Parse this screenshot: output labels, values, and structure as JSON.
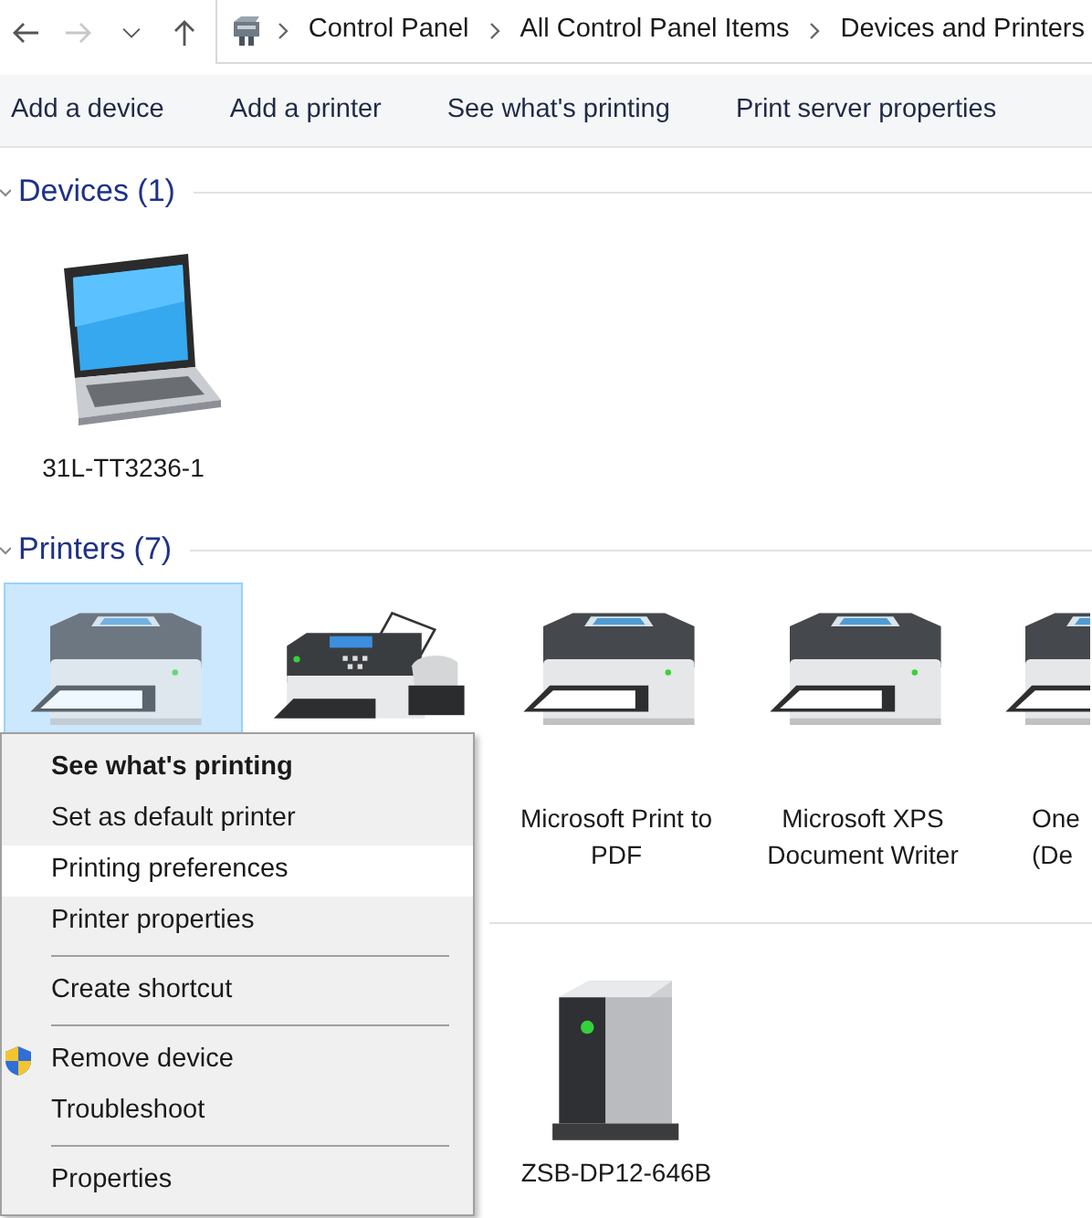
{
  "nav": [
    {
      "kind": "back",
      "disabled": false
    },
    {
      "kind": "forward",
      "disabled": true
    },
    {
      "kind": "recent",
      "disabled": false
    },
    {
      "kind": "up",
      "disabled": false
    }
  ],
  "breadcrumb": [
    "Control Panel",
    "All Control Panel Items",
    "Devices and Printers"
  ],
  "toolbar": [
    "Add a device",
    "Add a printer",
    "See what's printing",
    "Print server properties"
  ],
  "groups": [
    {
      "title": "Devices (1)",
      "items": [
        {
          "kind": "laptop",
          "label": "31L-TT3236-1",
          "selected": false
        }
      ]
    },
    {
      "title": "Printers (7)",
      "items": [
        {
          "kind": "printer",
          "selected": true
        },
        {
          "kind": "fax",
          "selected": false
        },
        {
          "kind": "printer",
          "label": "Microsoft Print to PDF",
          "selected": false
        },
        {
          "kind": "printer",
          "label": "Microsoft XPS Document Writer",
          "selected": false
        },
        {
          "kind": "printer",
          "label": "One (De",
          "selected": false
        }
      ]
    },
    {
      "items": [
        {
          "kind": "storage",
          "label": "ZSB-DP12-646B",
          "selected": false
        }
      ]
    }
  ],
  "context_menu": [
    {
      "kind": "item",
      "label": "See what's printing",
      "default": true,
      "selected": false
    },
    {
      "kind": "item",
      "label": "Set as default printer",
      "default": false,
      "selected": false
    },
    {
      "kind": "item",
      "label": "Printing preferences",
      "default": false,
      "selected": true
    },
    {
      "kind": "item",
      "label": "Printer properties",
      "default": false,
      "selected": false
    },
    {
      "kind": "separator"
    },
    {
      "kind": "item",
      "label": "Create shortcut",
      "default": false,
      "selected": false
    },
    {
      "kind": "separator"
    },
    {
      "kind": "item",
      "label": "Remove device",
      "default": false,
      "selected": false,
      "shield": true
    },
    {
      "kind": "item",
      "label": "Troubleshoot",
      "default": false,
      "selected": false
    },
    {
      "kind": "separator"
    },
    {
      "kind": "item",
      "label": "Properties",
      "default": false,
      "selected": false
    }
  ]
}
